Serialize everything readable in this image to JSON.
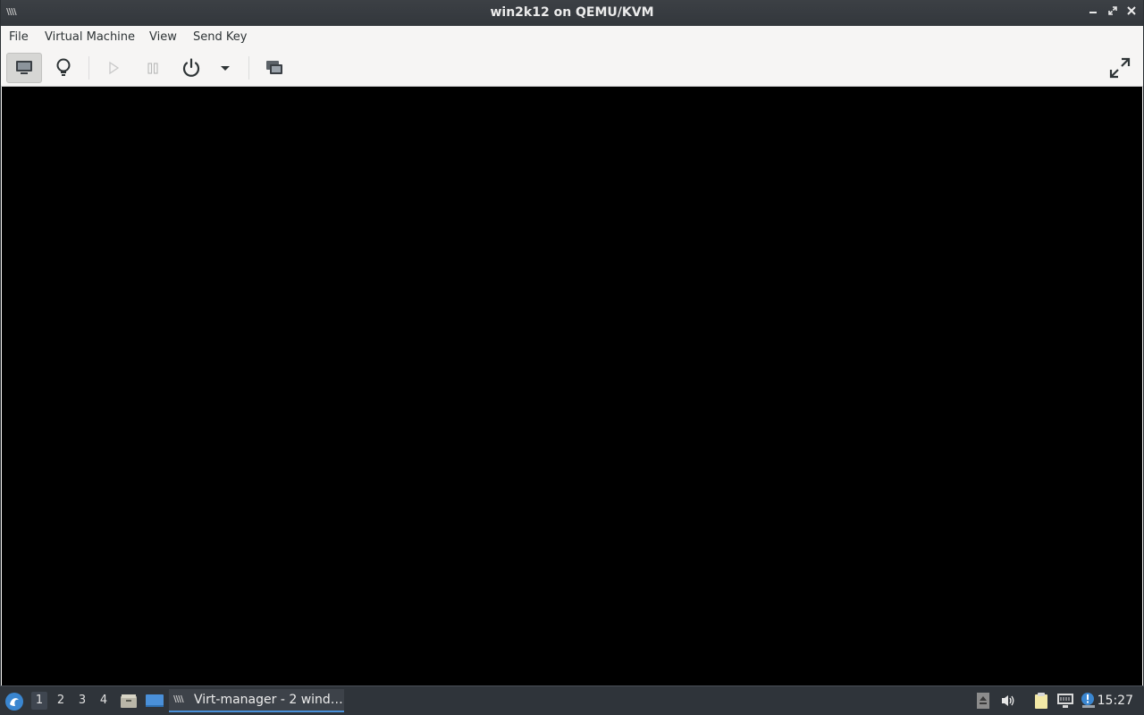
{
  "window": {
    "title": "win2k12 on QEMU/KVM",
    "app_icon_text": "\\\\\\\\",
    "buttons": {
      "minimize": "‒",
      "maximize": "⤢",
      "close": "✕"
    }
  },
  "menubar": {
    "items": [
      {
        "label": "File"
      },
      {
        "label": "Virtual Machine"
      },
      {
        "label": "View"
      },
      {
        "label": "Send Key"
      }
    ]
  },
  "toolbar": {
    "buttons": [
      {
        "name": "console",
        "icon": "monitor-icon",
        "active": true,
        "enabled": true
      },
      {
        "name": "details",
        "icon": "lightbulb-icon",
        "active": false,
        "enabled": true
      },
      {
        "name": "run",
        "icon": "play-icon",
        "active": false,
        "enabled": false
      },
      {
        "name": "pause",
        "icon": "pause-icon",
        "active": false,
        "enabled": false
      },
      {
        "name": "shutdown",
        "icon": "power-icon",
        "active": false,
        "enabled": true
      },
      {
        "name": "shutdown-menu",
        "icon": "chevron-down-icon",
        "active": false,
        "enabled": true
      },
      {
        "name": "snapshots",
        "icon": "snapshots-icon",
        "active": false,
        "enabled": true
      },
      {
        "name": "fullscreen",
        "icon": "fullscreen-icon",
        "active": false,
        "enabled": true
      }
    ]
  },
  "display": {
    "background": "#000000"
  },
  "taskbar": {
    "workspaces": [
      "1",
      "2",
      "3",
      "4"
    ],
    "active_workspace": "1",
    "task": {
      "label": "Virt-manager - 2 wind…",
      "icon_text": "\\\\\\\\"
    },
    "tray_icons": [
      "eject-icon",
      "volume-icon",
      "clipboard-icon",
      "network-icon",
      "update-notifier-icon"
    ],
    "clock": "15:27"
  },
  "colors": {
    "titlebar": "#363a3f",
    "menubar": "#f6f5f4",
    "taskbar": "#2f343a",
    "accent": "#4a90d9"
  }
}
